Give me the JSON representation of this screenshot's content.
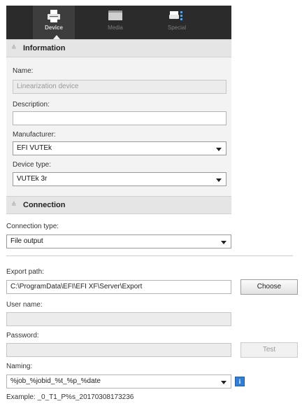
{
  "toolbar": {
    "tabs": [
      {
        "label": "Device",
        "icon": "printer-icon",
        "active": true
      },
      {
        "label": "Media",
        "icon": "media-icon",
        "active": false
      },
      {
        "label": "Special",
        "icon": "special-icon",
        "active": false
      }
    ]
  },
  "information": {
    "title": "Information",
    "name_label": "Name:",
    "name_value": "Linearization device",
    "description_label": "Description:",
    "description_value": "",
    "manufacturer_label": "Manufacturer:",
    "manufacturer_value": "EFI VUTEk",
    "device_type_label": "Device type:",
    "device_type_value": "VUTEk 3r"
  },
  "connection": {
    "title": "Connection",
    "connection_type_label": "Connection type:",
    "connection_type_value": "File output",
    "export_path_label": "Export path:",
    "export_path_value": "C:\\ProgramData\\EFI\\EFI XF\\Server\\Export",
    "choose_label": "Choose",
    "user_name_label": "User name:",
    "user_name_value": "",
    "password_label": "Password:",
    "password_value": "",
    "test_label": "Test",
    "naming_label": "Naming:",
    "naming_value": "%job_%jobid_%t_%p_%date",
    "info_label": "i",
    "example_text": "Example: _0_T1_P%s_20170308173236"
  },
  "colors": {
    "toolbar_bg": "#2b2b2b",
    "panel_bg": "#f3f3f3",
    "section_header_bg": "#e5e5e5",
    "info_blue": "#2f7fd6"
  }
}
